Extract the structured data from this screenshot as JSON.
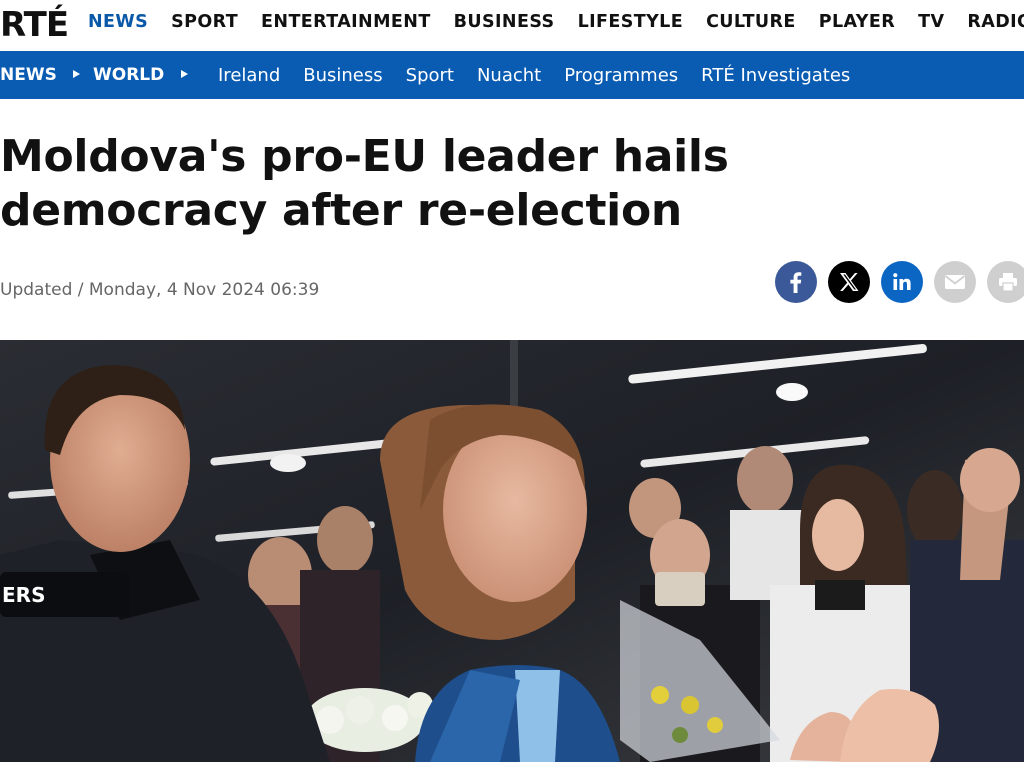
{
  "brand": {
    "logo_text": "RTÉ"
  },
  "topnav": {
    "items": [
      {
        "label": "NEWS",
        "active": true
      },
      {
        "label": "SPORT"
      },
      {
        "label": "ENTERTAINMENT"
      },
      {
        "label": "BUSINESS"
      },
      {
        "label": "LIFESTYLE"
      },
      {
        "label": "CULTURE"
      },
      {
        "label": "PLAYER"
      },
      {
        "label": "TV"
      },
      {
        "label": "RADIO"
      }
    ]
  },
  "subnav": {
    "breadcrumb": [
      "NEWS",
      "WORLD"
    ],
    "links": [
      "Ireland",
      "Business",
      "Sport",
      "Nuacht",
      "Programmes",
      "RTÉ Investigates"
    ]
  },
  "article": {
    "headline": "Moldova's pro-EU leader hails democracy after re-election",
    "dateline": "Updated / Monday, 4 Nov 2024 06:39"
  },
  "photo": {
    "overlay_text": "ERS"
  },
  "share": [
    {
      "name": "facebook-icon",
      "color": "#3b5998"
    },
    {
      "name": "x-icon",
      "color": "#000000"
    },
    {
      "name": "linkedin-icon",
      "color": "#0a66c2"
    },
    {
      "name": "email-icon",
      "color": "#cfcfcf"
    },
    {
      "name": "print-icon",
      "color": "#cfcfcf"
    }
  ],
  "colors": {
    "accent": "#0a5cb3",
    "active_nav": "#0a59a8"
  }
}
